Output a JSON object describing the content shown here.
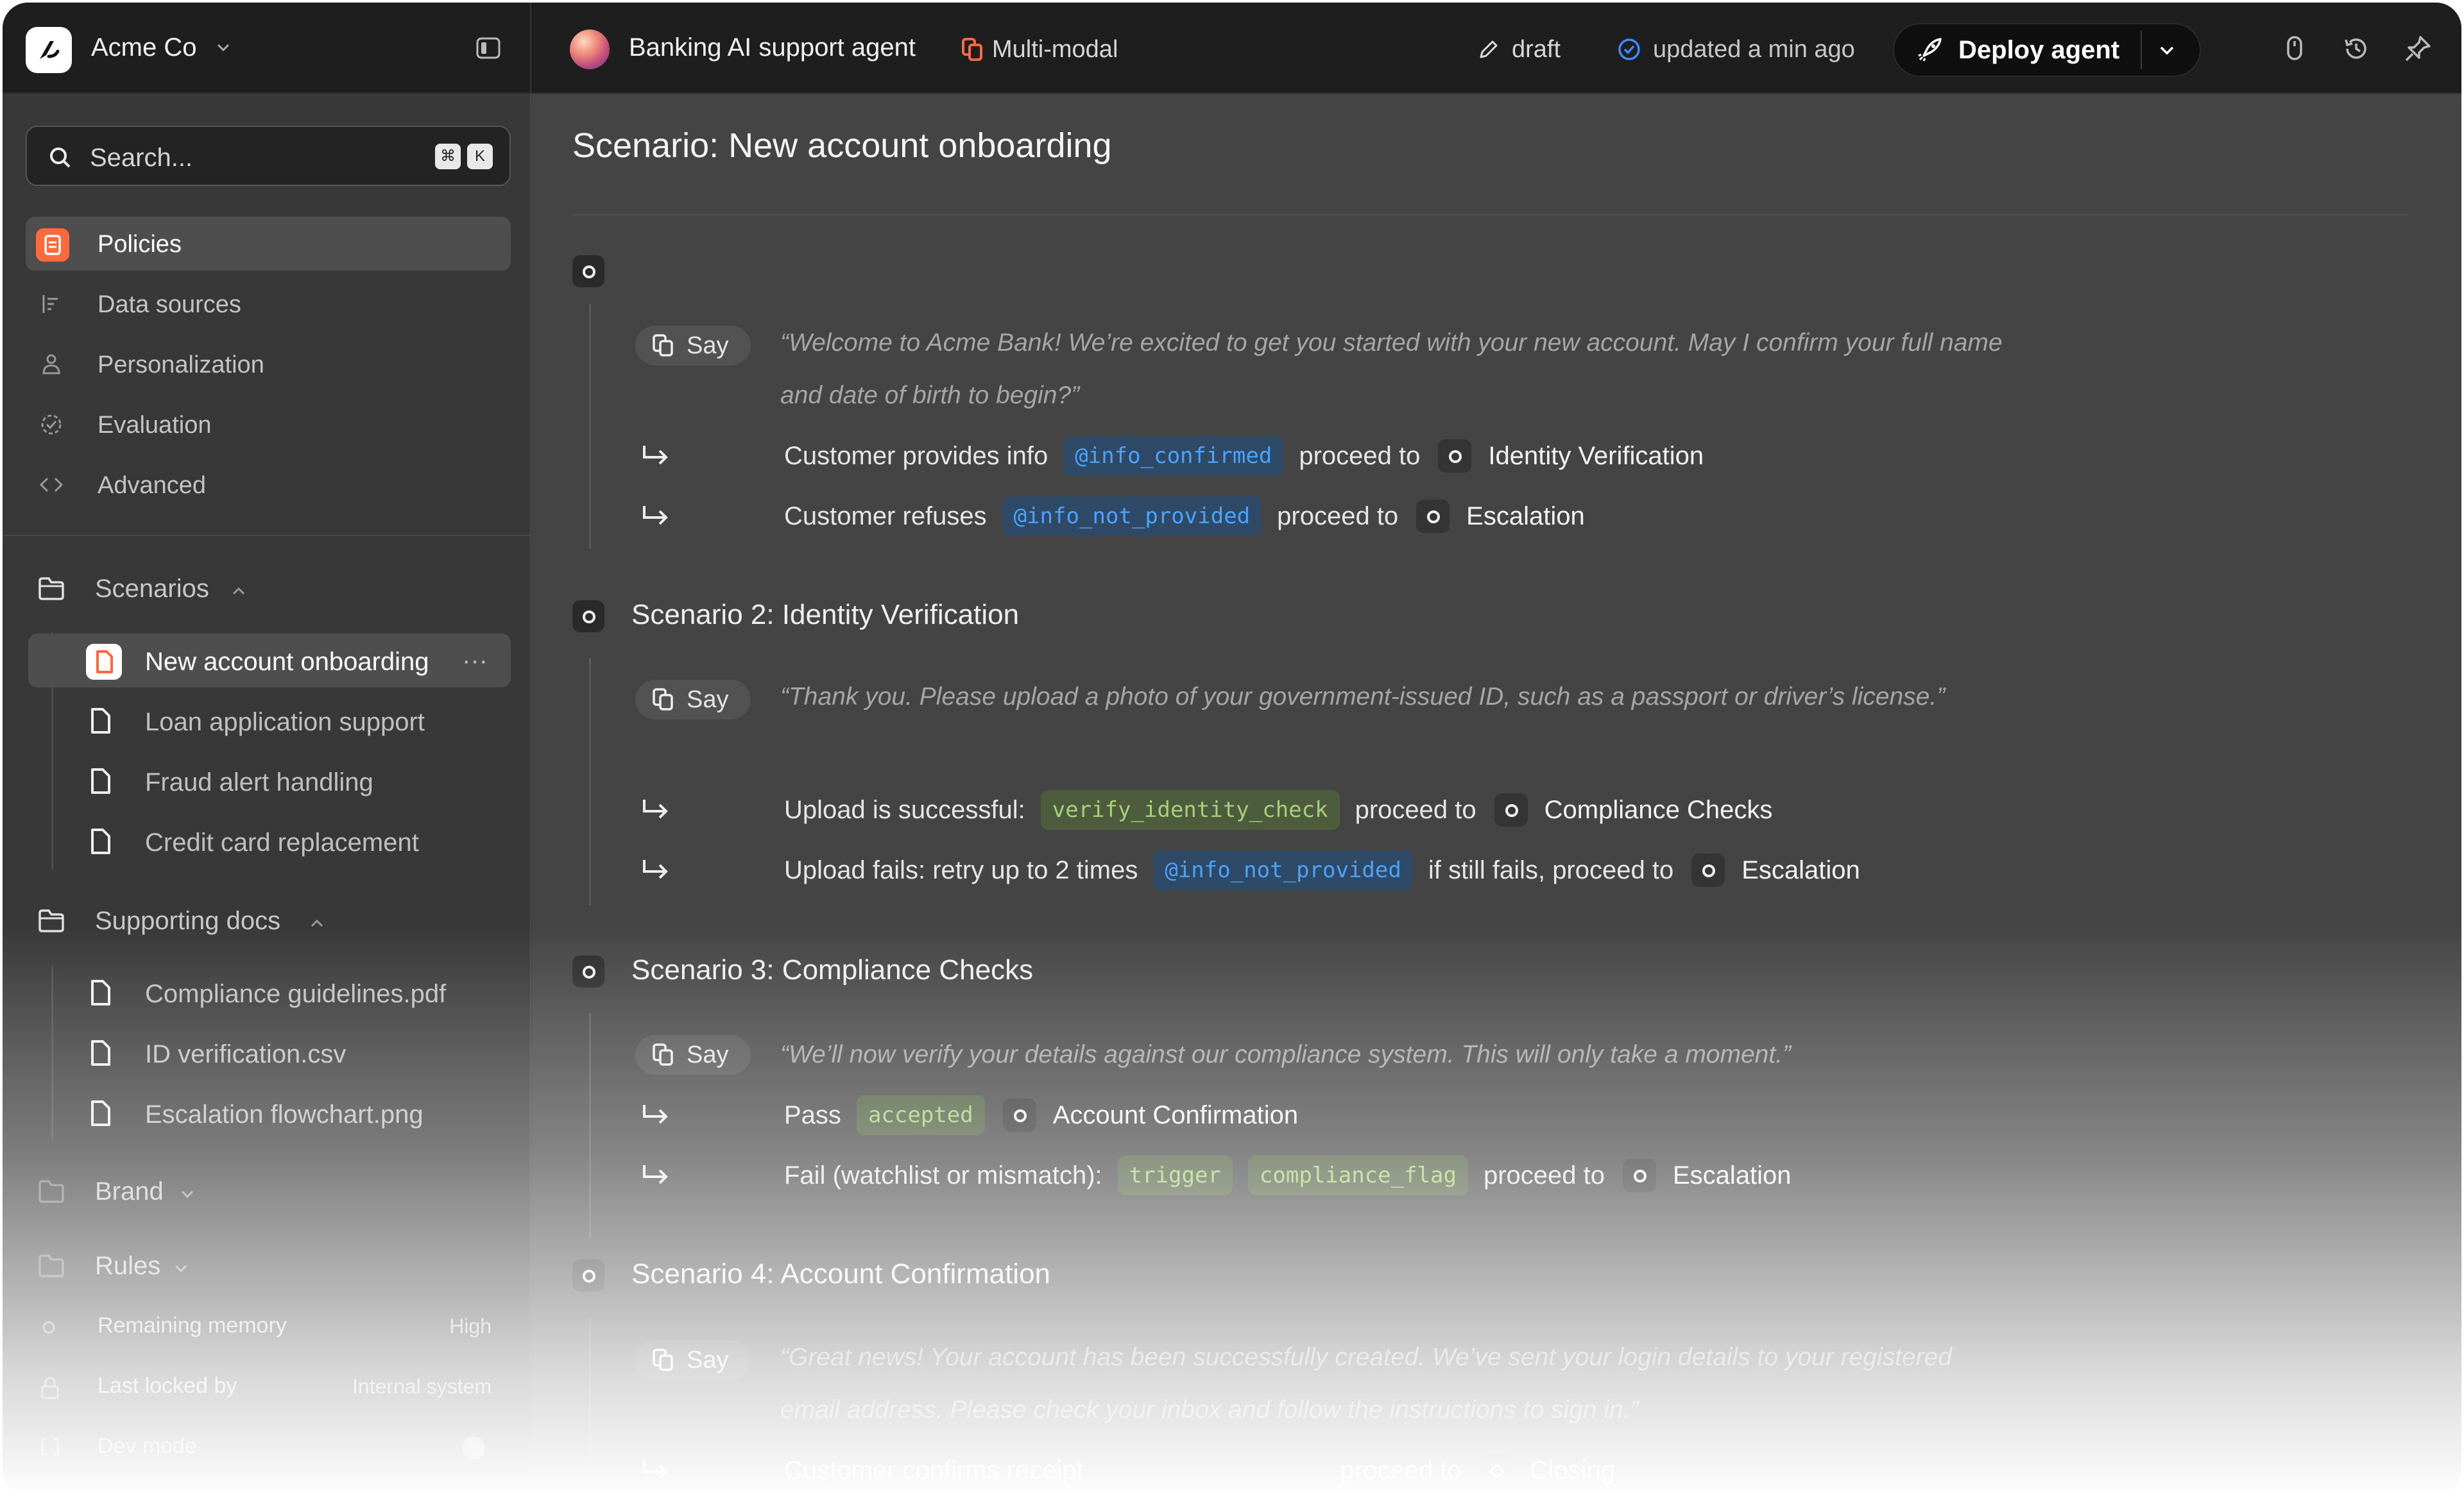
{
  "topbar": {
    "org_name": "Acme Co",
    "agent_name": "Banking AI support agent",
    "mode_label": "Multi-modal",
    "status_label": "draft",
    "updated_label": "updated a min ago",
    "deploy_label": "Deploy agent",
    "accent_color": "#ff6a3d"
  },
  "sidebar": {
    "search_placeholder": "Search...",
    "kbd_cmd": "⌘",
    "kbd_key": "K",
    "nav": [
      {
        "label": "Policies",
        "icon": "policy-icon",
        "active": true
      },
      {
        "label": "Data sources",
        "icon": "data-sources-icon"
      },
      {
        "label": "Personalization",
        "icon": "person-icon"
      },
      {
        "label": "Evaluation",
        "icon": "evaluation-icon"
      },
      {
        "label": "Advanced",
        "icon": "code-icon"
      }
    ],
    "scenarios": {
      "label": "Scenarios",
      "items": [
        "New account onboarding",
        "Loan application support",
        "Fraud alert handling",
        "Credit card replacement"
      ],
      "active_more": "···"
    },
    "supporting_docs": {
      "label": "Supporting docs",
      "items": [
        "Compliance guidelines.pdf",
        "ID verification.csv",
        "Escalation flowchart.png"
      ]
    },
    "brand_label": "Brand",
    "rules_label": "Rules",
    "meta": [
      {
        "label": "Remaining memory",
        "value": "High"
      },
      {
        "label": "Last locked by",
        "value": "Internal system"
      },
      {
        "label": "Dev mode",
        "value": ""
      }
    ]
  },
  "main": {
    "title": "Scenario: New account onboarding",
    "say_label": "Say",
    "scenarios": [
      {
        "title": "",
        "say": "“Welcome to Acme Bank! We’re excited to get you started with your new account. May I confirm your full name and date of birth to begin?”",
        "branches": [
          {
            "text": "Customer provides info",
            "tags": [
              {
                "label": "@info_confirmed",
                "color": "blue"
              }
            ],
            "connector": "proceed to",
            "target": "Identity Verification"
          },
          {
            "text": "Customer refuses",
            "tags": [
              {
                "label": "@info_not_provided",
                "color": "blue"
              }
            ],
            "connector": "proceed to",
            "target": "Escalation"
          }
        ]
      },
      {
        "title": "Scenario 2: Identity Verification",
        "say": "“Thank you. Please upload a photo of your government-issued ID, such as a passport or driver’s license.”",
        "branches": [
          {
            "text": "Upload is successful:",
            "tags": [
              {
                "label": "verify_identity_check",
                "color": "green"
              }
            ],
            "connector": "proceed to",
            "target": "Compliance Checks"
          },
          {
            "text": "Upload fails: retry up to 2 times",
            "tags": [
              {
                "label": "@info_not_provided",
                "color": "blue"
              }
            ],
            "connector": "if still fails, proceed to",
            "target": "Escalation"
          }
        ]
      },
      {
        "title": "Scenario 3: Compliance Checks",
        "say": "“We’ll now verify your details against our compliance system. This will only take a moment.”",
        "branches": [
          {
            "text": "Pass",
            "tags": [
              {
                "label": "accepted",
                "color": "green"
              }
            ],
            "connector": "",
            "target": "Account Confirmation"
          },
          {
            "text": "Fail (watchlist or mismatch):",
            "tags": [
              {
                "label": "trigger",
                "color": "green"
              },
              {
                "label": "compliance_flag",
                "color": "green"
              }
            ],
            "connector": "proceed to",
            "target": "Escalation"
          }
        ]
      },
      {
        "title": "Scenario 4: Account Confirmation",
        "say": "“Great news! Your account has been successfully created. We’ve sent your login details to your registered email address. Please check your inbox and follow the instructions to sign in.”",
        "branches": [
          {
            "text": "Customer confirms receipt",
            "tags": [],
            "connector": "proceed to",
            "target": "Closing"
          }
        ]
      }
    ]
  }
}
